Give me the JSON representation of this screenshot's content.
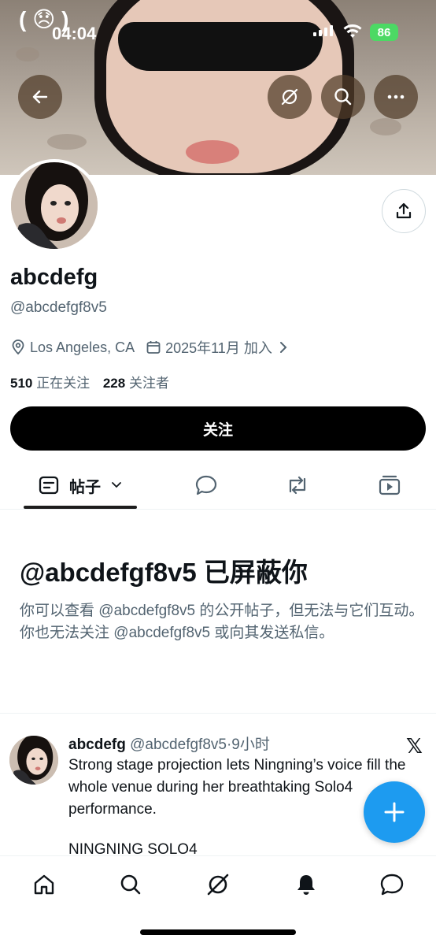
{
  "status_bar": {
    "time": "04:04",
    "battery": "86",
    "emoji": "( 😞 )"
  },
  "profile": {
    "display_name": "abcdefg",
    "handle": "@abcdefgf8v5",
    "location": "Los Angeles, CA",
    "joined": "2025年11月 加入",
    "following_count": "510",
    "following_label": "正在关注",
    "followers_count": "228",
    "followers_label": "关注者",
    "follow_button": "关注"
  },
  "tabs": {
    "posts_label": "帖子"
  },
  "blocked": {
    "title": "@abcdefgf8v5 已屏蔽你",
    "description": "你可以查看 @abcdefgf8v5 的公开帖子，但无法与它们互动。你也无法关注 @abcdefgf8v5 或向其发送私信。"
  },
  "post": {
    "name": "abcdefg",
    "handle_time": "@abcdefgf8v5·9小时",
    "text": "Strong stage projection lets Ningning’s voice fill the whole venue during her breathtaking Solo4 performance.",
    "tag": "NINGNING SOLO4"
  },
  "colors": {
    "accent": "#1d9bf0",
    "text": "#0f1419",
    "muted": "#536471"
  }
}
